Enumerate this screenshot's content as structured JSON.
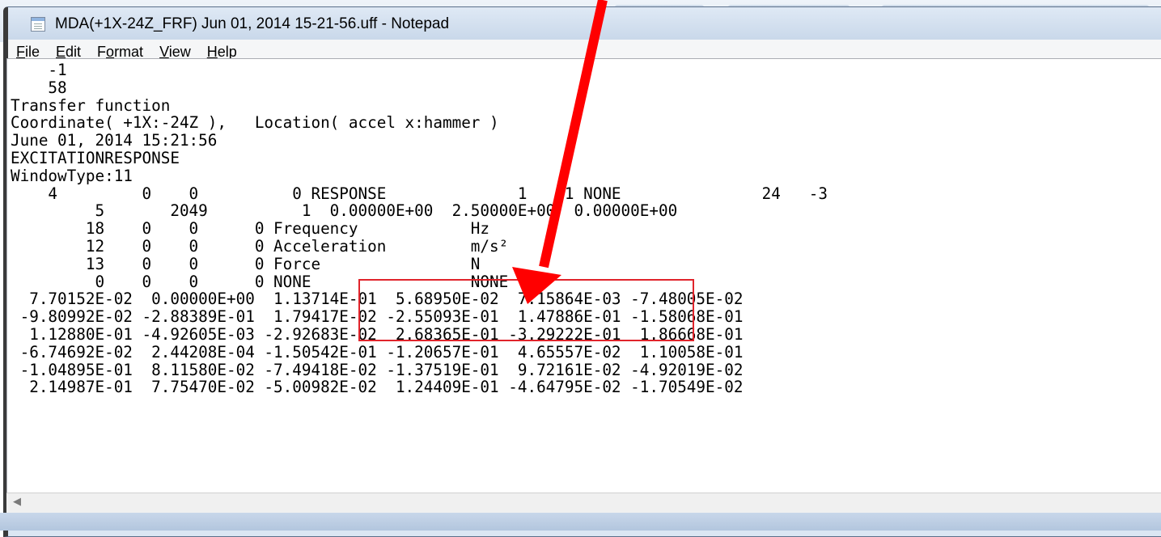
{
  "window": {
    "title": "MDA(+1X-24Z_FRF) Jun 01, 2014 15-21-56.uff - Notepad"
  },
  "menu": {
    "items": [
      {
        "mnemonic": "F",
        "rest": "ile"
      },
      {
        "mnemonic": "E",
        "rest": "dit"
      },
      {
        "mnemonic": "o",
        "pre": "F",
        "rest": "rmat"
      },
      {
        "mnemonic": "V",
        "rest": "iew"
      },
      {
        "mnemonic": "H",
        "rest": "elp"
      }
    ]
  },
  "editor": {
    "lines": [
      "    -1",
      "    58",
      "Transfer function",
      "Coordinate( +1X:-24Z ),   Location( accel x:hammer )",
      "June 01, 2014 15:21:56",
      "EXCITATIONRESPONSE",
      "WindowType:11",
      "    4         0    0          0 RESPONSE              1    1 NONE               24   -3",
      "         5       2049          1  0.00000E+00  2.50000E+00  0.00000E+00",
      "        18    0    0      0 Frequency            Hz",
      "        12    0    0      0 Acceleration         m/s²",
      "        13    0    0      0 Force                N",
      "         0    0    0      0 NONE                 NONE",
      "  7.70152E-02  0.00000E+00  1.13714E-01  5.68950E-02  7.15864E-03 -7.48005E-02",
      " -9.80992E-02 -2.88389E-01  1.79417E-02 -2.55093E-01  1.47886E-01 -1.58068E-01",
      "  1.12880E-01 -4.92605E-03 -2.92683E-02  2.68365E-01 -3.29222E-01  1.86668E-01",
      " -6.74692E-02  2.44208E-04 -1.50542E-01 -1.20657E-01  4.65557E-02  1.10058E-01",
      " -1.04895E-01  8.11580E-02 -7.49418E-02 -1.37519E-01  9.72161E-02 -4.92019E-02",
      "  2.14987E-01  7.75470E-02 -5.00982E-02  1.24409E-01 -4.64795E-02 -1.70549E-02"
    ]
  },
  "annotation": {
    "arrow_color": "#ff0000",
    "box_color": "#e0242b"
  },
  "icons": {
    "app": "notepad-icon",
    "scroll_left": "scroll-left-arrow-icon"
  }
}
